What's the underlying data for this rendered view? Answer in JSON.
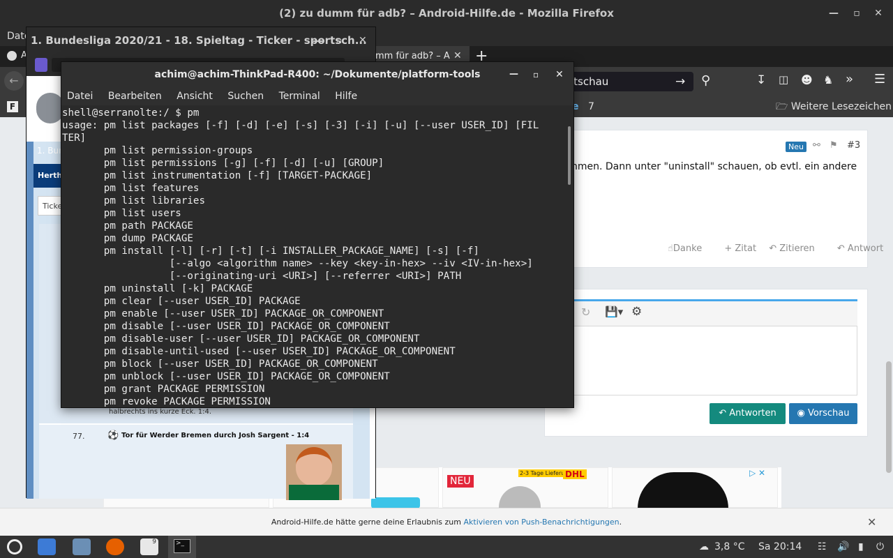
{
  "firefox": {
    "window_title": "(2) zu dumm für adb? – Android-Hilfe.de - Mozilla Firefox",
    "menu_first": "Date",
    "tab_left_letter": "A",
    "active_tab": "mm für adb? – A",
    "url_text": "rtschau",
    "bookmark_count": "7",
    "bookmarks_more": "Weitere Lesezeichen"
  },
  "post": {
    "badge": "Neu",
    "number": "#3",
    "text": "nmen. Dann unter \"uninstall\" schauen, ob evtl. ein andere",
    "actions": [
      "Danke",
      "+ Zitat",
      "Zitieren",
      "Antwort"
    ]
  },
  "editor": {
    "reply_button": "Antworten",
    "preview_button": "Vorschau"
  },
  "ads": {
    "badge": "NEU",
    "promo": "2-3 Tage Lieferung",
    "brand": "DHL"
  },
  "push_banner": {
    "text": "Android-Hilfe.de hätte gerne deine Erlaubnis zum ",
    "link": "Aktivieren von Push-Benachrichtigungen",
    "end": "."
  },
  "sportschau": {
    "window_title": "1. Bundesliga 2020/21 - 18. Spieltag - Ticker - sportsch...",
    "headline": "1. Bun",
    "team_tab": "Hertha",
    "ticker_tab": "Ticker",
    "prev_text": "halbrechts ins kurze Eck. 1:4.",
    "minute": "77.",
    "event": "Tor für Werder Bremen durch Josh Sargent - 1:4"
  },
  "terminal": {
    "window_title": "achim@achim-ThinkPad-R400: ~/Dokumente/platform-tools",
    "menu": [
      "Datei",
      "Bearbeiten",
      "Ansicht",
      "Suchen",
      "Terminal",
      "Hilfe"
    ],
    "lines": [
      "shell@serranolte:/ $ pm",
      "usage: pm list packages [-f] [-d] [-e] [-s] [-3] [-i] [-u] [--user USER_ID] [FIL",
      "TER]",
      "       pm list permission-groups",
      "       pm list permissions [-g] [-f] [-d] [-u] [GROUP]",
      "       pm list instrumentation [-f] [TARGET-PACKAGE]",
      "       pm list features",
      "       pm list libraries",
      "       pm list users",
      "       pm path PACKAGE",
      "       pm dump PACKAGE",
      "       pm install [-l] [-r] [-t] [-i INSTALLER_PACKAGE_NAME] [-s] [-f]",
      "                  [--algo <algorithm name> --key <key-in-hex> --iv <IV-in-hex>]",
      "                  [--originating-uri <URI>] [--referrer <URI>] PATH",
      "       pm uninstall [-k] PACKAGE",
      "       pm clear [--user USER_ID] PACKAGE",
      "       pm enable [--user USER_ID] PACKAGE_OR_COMPONENT",
      "       pm disable [--user USER_ID] PACKAGE_OR_COMPONENT",
      "       pm disable-user [--user USER_ID] PACKAGE_OR_COMPONENT",
      "       pm disable-until-used [--user USER_ID] PACKAGE_OR_COMPONENT",
      "       pm block [--user USER_ID] PACKAGE_OR_COMPONENT",
      "       pm unblock [--user USER_ID] PACKAGE_OR_COMPONENT",
      "       pm grant PACKAGE PERMISSION",
      "       pm revoke PACKAGE PERMISSION"
    ]
  },
  "taskbar": {
    "temperature": "3,8 °C",
    "clock": "Sa 20:14",
    "calendar_day": "9"
  },
  "colors": {
    "terminal_bg": "#2a2a2a",
    "accent_teal": "#148a7e",
    "accent_blue": "#2577b1",
    "sport_blue": "#5f8ec2"
  }
}
